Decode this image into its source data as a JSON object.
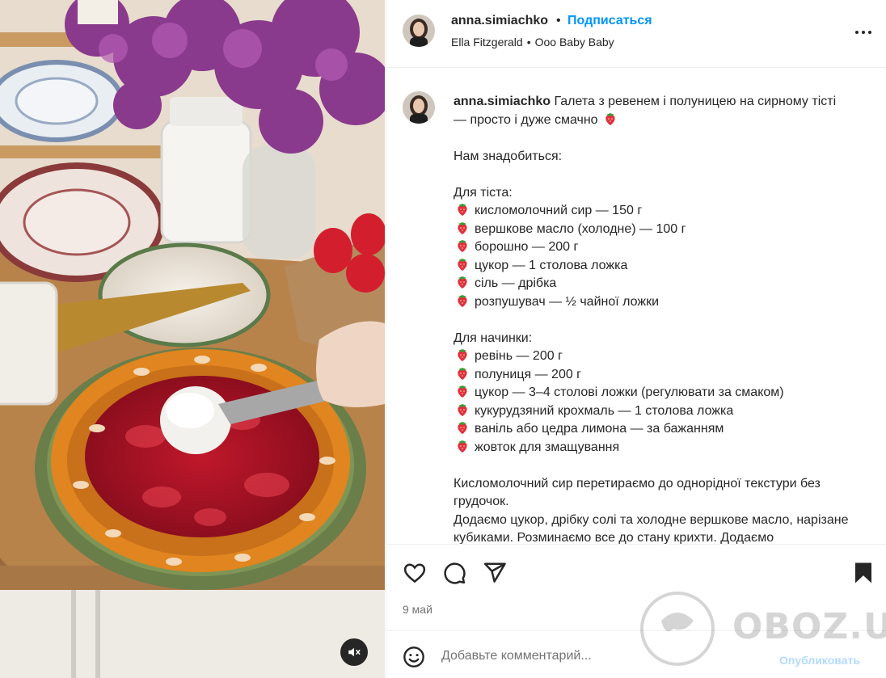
{
  "header": {
    "username": "anna.simiachko",
    "separator": "•",
    "follow_label": "Подписаться",
    "music_artist": "Ella Fitzgerald",
    "music_sep": "•",
    "music_track": "Ooo Baby Baby"
  },
  "caption": {
    "username": "anna.simiachko",
    "text_line1": "Галета з ревенем і полуницею на сирному тісті",
    "text_line2": "— просто і дуже смачно",
    "need_heading": "Нам знадобиться:",
    "dough_heading": "Для тіста:",
    "dough_items": [
      "кисломолочний сир — 150 г",
      "вершкове масло (холодне) — 100 г",
      "борошно — 200 г",
      "цукор — 1 столова ложка",
      "сіль — дрібка",
      "розпушувач — ½ чайної ложки"
    ],
    "filling_heading": "Для начинки:",
    "filling_items": [
      "ревінь — 200 г",
      "полуниця — 200 г",
      "цукор — 3–4 столові ложки (регулювати за смаком)",
      "кукурудзяний крохмаль — 1 столова ложка",
      "ваніль або цедра лимона — за бажанням",
      "жовток для змащування"
    ],
    "step1": "Кисломолочний сир перетираємо до однорідної текстури без грудочок.",
    "step2": "Додаємо цукор, дрібку солі та холодне вершкове масло, нарізане кубиками. Розминаємо все до стану крихти. Додаємо"
  },
  "actions": {
    "date": "9 май"
  },
  "comment_box": {
    "placeholder": "Добавьте комментарий...",
    "publish_label": "Опубликовать"
  },
  "watermark": {
    "text": "OBOZ.UA"
  },
  "icons": {
    "like": "heart-icon",
    "comment": "comment-bubble-icon",
    "share": "paper-plane-icon",
    "save": "bookmark-filled-icon",
    "emoji": "smiley-icon",
    "more": "ellipsis-icon",
    "mute": "speaker-muted-icon",
    "list_bullet": "strawberry-icon"
  },
  "colors": {
    "link_blue": "#0095f6",
    "publish_disabled": "#b3dbff",
    "muted_text": "#737373",
    "divider": "#efefef"
  }
}
